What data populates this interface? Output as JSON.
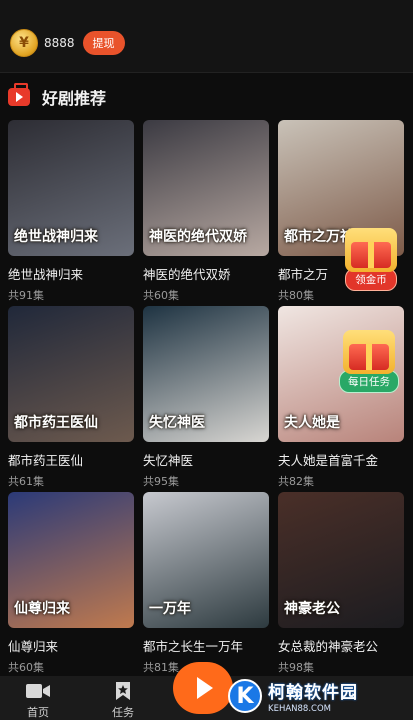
{
  "coins": {
    "amount": "8888",
    "withdraw_label": "提现",
    "icon": "coin-icon"
  },
  "section": {
    "title": "好剧推荐",
    "icon": "tv-play-icon"
  },
  "dramas": [
    {
      "title": "绝世战神归来",
      "episodes": "共91集",
      "poster_text": "绝世战神归来",
      "c1": "#2d2d34",
      "c2": "#6b6f7a"
    },
    {
      "title": "神医的绝代双娇",
      "episodes": "共60集",
      "poster_text": "神医的绝代双娇",
      "c1": "#3b3a42",
      "c2": "#b8a9a2"
    },
    {
      "title": "都市之万",
      "episodes": "共80集",
      "poster_text": "都市之万神",
      "c1": "#c9c2b8",
      "c2": "#7d5a48"
    },
    {
      "title": "都市药王医仙",
      "episodes": "共61集",
      "poster_text": "都市药王医仙",
      "c1": "#20283a",
      "c2": "#6d5a4e"
    },
    {
      "title": "失忆神医",
      "episodes": "共95集",
      "poster_text": "失忆神医",
      "c1": "#1e3342",
      "c2": "#d8d6d2"
    },
    {
      "title": "夫人她是首富千金",
      "episodes": "共82集",
      "poster_text": "夫人她是",
      "c1": "#f0e6e2",
      "c2": "#b8837a"
    },
    {
      "title": "仙尊归来",
      "episodes": "共60集",
      "poster_text": "仙尊归来",
      "c1": "#2b3a78",
      "c2": "#c07a4e"
    },
    {
      "title": "都市之长生一万年",
      "episodes": "共81集",
      "poster_text": "一万年",
      "c1": "#c7c9cf",
      "c2": "#2d3a3f"
    },
    {
      "title": "女总裁的神豪老公",
      "episodes": "共98集",
      "poster_text": "神豪老公",
      "c1": "#4a2f28",
      "c2": "#1c1c20"
    }
  ],
  "widgets": {
    "coin_reward_label": "领金币",
    "daily_task_label": "每日任务"
  },
  "nav": {
    "home_label": "首页",
    "tasks_label": "任务"
  },
  "watermark": {
    "title": "柯翰软件园",
    "url": "KEHAN88.COM",
    "logo_letter": "K"
  },
  "colors": {
    "accent": "#e9532b",
    "play": "#ff6a1a",
    "brand_red": "#e83a2a"
  }
}
